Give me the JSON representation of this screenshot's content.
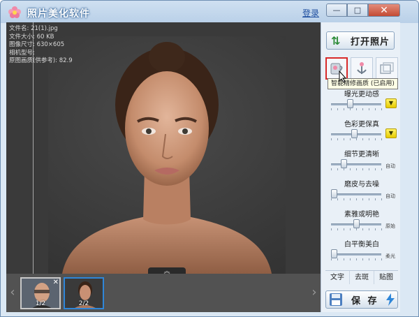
{
  "window": {
    "title": "照片美化软件",
    "login_link": "登录",
    "minimize_glyph": "—",
    "maximize_glyph": "□",
    "close_glyph": "✕"
  },
  "photo_info": {
    "file_name": "文件名: 21(1).jpg",
    "file_size": "文件大小: 60 KB",
    "image_size": "图像尺寸: 630×605",
    "camera_model": "相机型号:",
    "original_quality": "原图画质(供参考): 82.9"
  },
  "photo_area": {
    "expand_glyph": "︽"
  },
  "filmstrip": {
    "left_arrow": "‹",
    "right_arrow": "›",
    "thumbnails": [
      {
        "label": "1/2",
        "close": "✕",
        "active": false
      },
      {
        "label": "2/2",
        "active": true
      }
    ]
  },
  "panel": {
    "open_button": "打开照片",
    "tooltip": "智能精修画质 (已启用)",
    "sliders": [
      {
        "label": "曝光更动感",
        "level": 0.38,
        "mode": "",
        "dropdown": true
      },
      {
        "label": "色彩更保真",
        "level": 0.46,
        "mode": "",
        "dropdown": true
      },
      {
        "label": "细节更清晰",
        "level": 0.25,
        "mode": "自动",
        "dropdown": false
      },
      {
        "label": "磨皮与去噪",
        "level": 0.05,
        "mode": "自动",
        "dropdown": false
      },
      {
        "label": "素雅或明艳",
        "level": 0.5,
        "mode": "原始",
        "dropdown": false
      },
      {
        "label": "白平衡美白",
        "level": 0.05,
        "mode": "柔光",
        "dropdown": false
      }
    ],
    "tabs": [
      "文字",
      "去斑",
      "贴图"
    ],
    "save_button": "保 存"
  },
  "colors": {
    "selection_border": "#d82a2a",
    "active_thumb": "#2f86d8",
    "dropdown_yellow": "#f2dc1c"
  }
}
